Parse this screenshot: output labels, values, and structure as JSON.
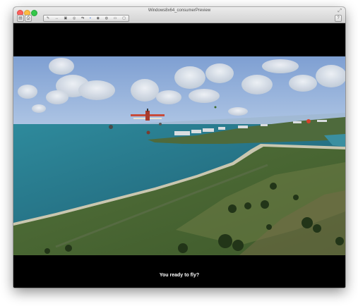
{
  "window": {
    "title": "Windows8x64_consumerPreview",
    "controls": {
      "close": "close-icon",
      "minimize": "minimize-icon",
      "zoom": "zoom-icon",
      "fullscreen": "fullscreen-icon"
    }
  },
  "toolbar": {
    "left_buttons": [
      {
        "icon": "sidebar-icon",
        "glyph": "▤"
      },
      {
        "icon": "snapshot-icon",
        "glyph": "⎙"
      }
    ],
    "tools": [
      {
        "icon": "wrench-icon",
        "glyph": "✎"
      },
      {
        "icon": "arrows-icon",
        "glyph": "↔"
      },
      {
        "icon": "disk-icon",
        "glyph": "▣"
      },
      {
        "icon": "cd-icon",
        "glyph": "◎"
      },
      {
        "icon": "network-icon",
        "glyph": "⇆"
      },
      {
        "icon": "usb-icon",
        "glyph": "▪",
        "active": true
      },
      {
        "icon": "camera-icon",
        "glyph": "◉"
      },
      {
        "icon": "sound-icon",
        "glyph": "◍"
      },
      {
        "icon": "printer-icon",
        "glyph": "▭"
      },
      {
        "icon": "display-icon",
        "glyph": "▢"
      }
    ],
    "right_button": {
      "icon": "help-icon",
      "glyph": "?"
    }
  },
  "game": {
    "subtitle": "You ready to fly?",
    "scene_colors": {
      "sky": "#8fb1dc",
      "ocean": "#2a7f93",
      "land": "#4f6b34"
    }
  }
}
